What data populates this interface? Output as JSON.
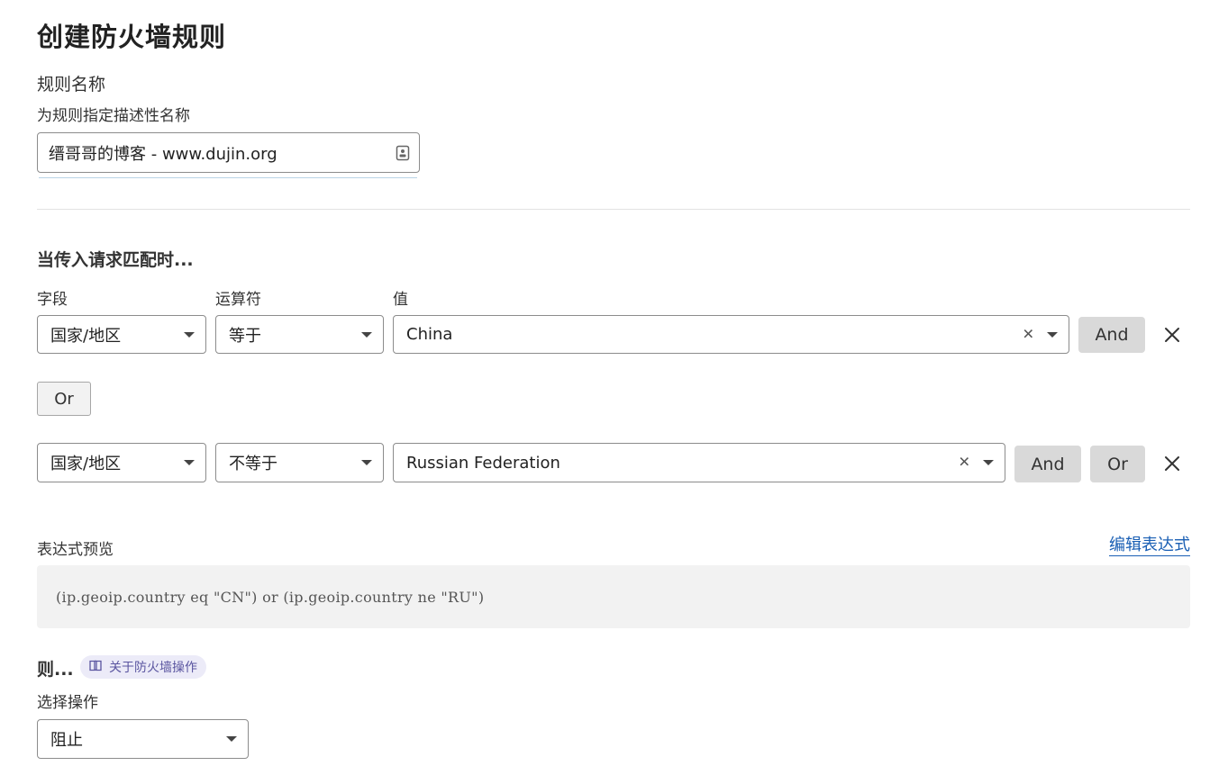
{
  "page": {
    "title": "创建防火墙规则"
  },
  "rule_name": {
    "label": "规则名称",
    "hint": "为规则指定描述性名称",
    "value": "缙哥哥的博客 - www.dujin.org"
  },
  "match": {
    "heading": "当传入请求匹配时...",
    "columns": {
      "field": "字段",
      "operator": "运算符",
      "value": "值"
    },
    "rows": [
      {
        "field": "国家/地区",
        "operator": "等于",
        "value": "China",
        "buttons": [
          "And"
        ]
      },
      {
        "field": "国家/地区",
        "operator": "不等于",
        "value": "Russian Federation",
        "buttons": [
          "And",
          "Or"
        ]
      }
    ],
    "or_label": "Or"
  },
  "expression": {
    "label": "表达式预览",
    "edit_link": "编辑表达式",
    "text": "(ip.geoip.country eq \"CN\") or (ip.geoip.country ne \"RU\")"
  },
  "then": {
    "heading": "则...",
    "chip_label": "关于防火墙操作",
    "action_label": "选择操作",
    "action_value": "阻止"
  },
  "icons": [
    "contact-card-icon",
    "clear-icon",
    "chevron-down-icon",
    "close-icon",
    "book-icon"
  ]
}
